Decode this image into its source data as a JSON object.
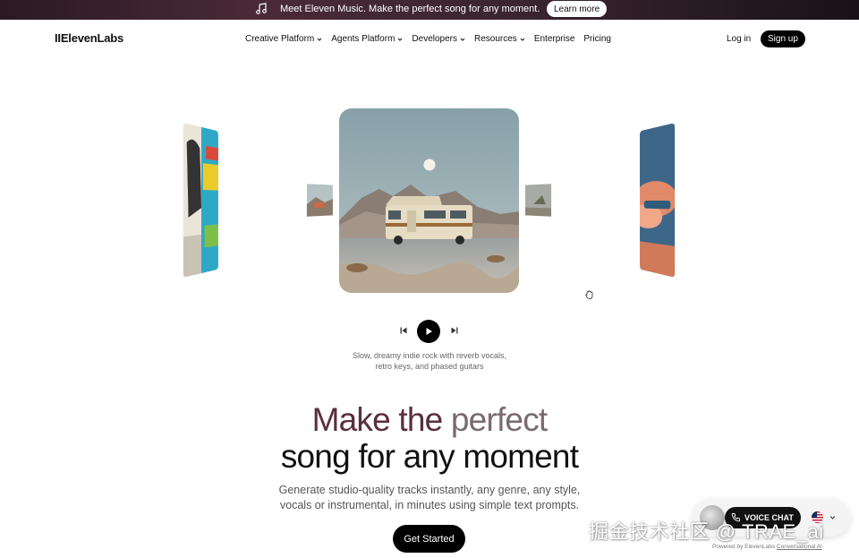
{
  "banner": {
    "text": "Meet Eleven Music. Make the perfect song for any moment.",
    "cta": "Learn more"
  },
  "nav": {
    "logo": "IIElevenLabs",
    "items": [
      {
        "label": "Creative Platform",
        "has_dropdown": true
      },
      {
        "label": "Agents Platform",
        "has_dropdown": true
      },
      {
        "label": "Developers",
        "has_dropdown": true
      },
      {
        "label": "Resources",
        "has_dropdown": true
      },
      {
        "label": "Enterprise",
        "has_dropdown": false
      },
      {
        "label": "Pricing",
        "has_dropdown": false
      }
    ],
    "login": "Log in",
    "signup": "Sign up"
  },
  "player": {
    "prompt_line1": "Slow, dreamy indie rock with reverb vocals,",
    "prompt_line2": "retro keys, and phased guitars"
  },
  "hero": {
    "line1_a": "Make the",
    "line1_b": "perfect",
    "line2": "song for any moment",
    "subtitle_line1": "Generate studio-quality tracks instantly, any genre, any style,",
    "subtitle_line2": "vocals or instrumental, in minutes using simple text prompts.",
    "cta": "Get Started"
  },
  "voice_widget": {
    "button": "VOICE CHAT",
    "powered_prefix": "Powered by ElevenLabs",
    "powered_link": "Conversational AI"
  },
  "watermark": "掘金技术社区 @ TRAE_ai",
  "colors": {
    "brand_black": "#000000",
    "hero_accent": "#5a2f3b",
    "hero_muted": "#7a6a70"
  }
}
